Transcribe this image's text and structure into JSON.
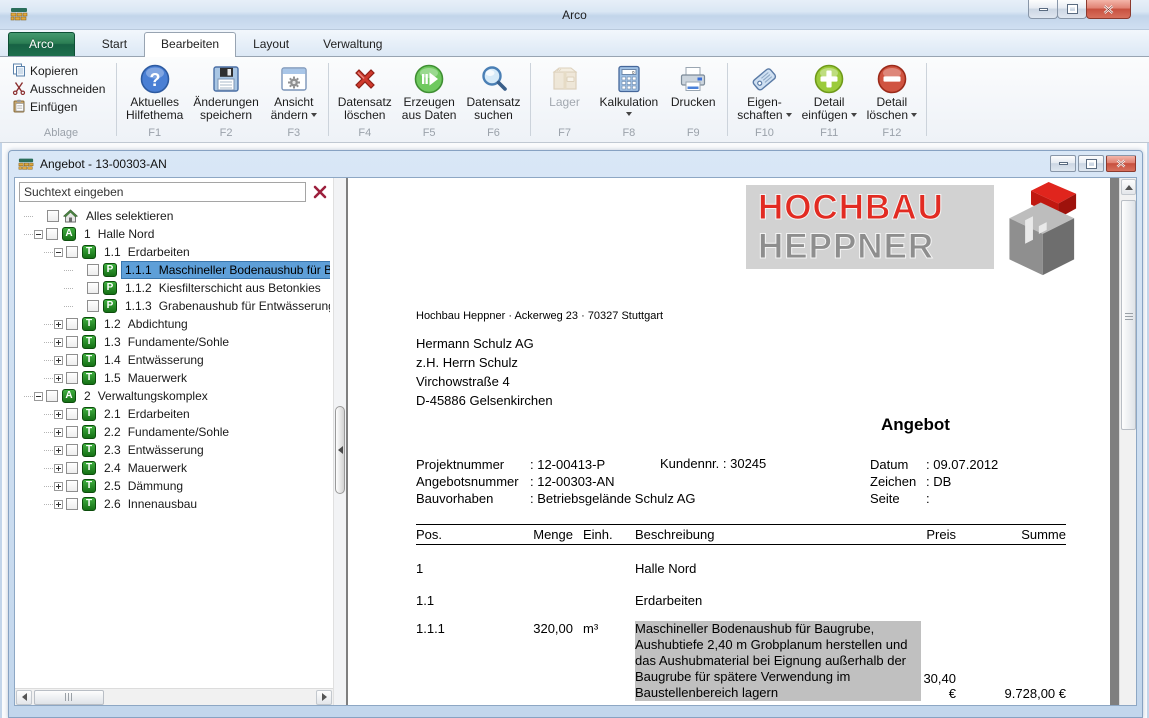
{
  "window": {
    "title": "Arco"
  },
  "tabs": {
    "app": "Arco",
    "items": [
      "Start",
      "Bearbeiten",
      "Layout",
      "Verwaltung"
    ],
    "active": "Bearbeiten"
  },
  "ribbon": {
    "small_group": {
      "label": "Ablage",
      "items": [
        {
          "label": "Kopieren",
          "icon": "copy"
        },
        {
          "label": "Ausschneiden",
          "icon": "scissors"
        },
        {
          "label": "Einfügen",
          "icon": "paste"
        }
      ]
    },
    "separators_after": [
      "F3",
      "F6",
      "F9",
      "F12"
    ],
    "buttons": [
      {
        "line1": "Aktuelles",
        "line2": "Hilfethema",
        "key": "F1",
        "icon": "help",
        "dropdown": false,
        "disabled": false
      },
      {
        "line1": "Änderungen",
        "line2": "speichern",
        "key": "F2",
        "icon": "save",
        "dropdown": false,
        "disabled": false
      },
      {
        "line1": "Ansicht",
        "line2": "ändern",
        "key": "F3",
        "icon": "view",
        "dropdown": true,
        "disabled": false
      },
      {
        "line1": "Datensatz",
        "line2": "löschen",
        "key": "F4",
        "icon": "delete-x",
        "dropdown": false,
        "disabled": false
      },
      {
        "line1": "Erzeugen",
        "line2": "aus Daten",
        "key": "F5",
        "icon": "generate",
        "dropdown": false,
        "disabled": false
      },
      {
        "line1": "Datensatz",
        "line2": "suchen",
        "key": "F6",
        "icon": "search",
        "dropdown": false,
        "disabled": false
      },
      {
        "line1": "Lager",
        "line2": "",
        "key": "F7",
        "icon": "package",
        "dropdown": false,
        "disabled": true
      },
      {
        "line1": "Kalkulation",
        "line2": "",
        "key": "F8",
        "icon": "calculator",
        "dropdown": true,
        "disabled": false
      },
      {
        "line1": "Drucken",
        "line2": "",
        "key": "F9",
        "icon": "printer",
        "dropdown": false,
        "disabled": false
      },
      {
        "line1": "Eigen-",
        "line2": "schaften",
        "key": "F10",
        "icon": "tag",
        "dropdown": true,
        "disabled": false
      },
      {
        "line1": "Detail",
        "line2": "einfügen",
        "key": "F11",
        "icon": "plus-circle",
        "dropdown": true,
        "disabled": false
      },
      {
        "line1": "Detail",
        "line2": "löschen",
        "key": "F12",
        "icon": "minus-circle",
        "dropdown": true,
        "disabled": false
      }
    ]
  },
  "child": {
    "title": "Angebot - 13-00303-AN",
    "search_value": "Suchtext eingeben",
    "tree": [
      {
        "num": "",
        "text": "Alles selektieren",
        "badge": "house",
        "level": 0,
        "expander": "none",
        "selected": false
      },
      {
        "num": "1",
        "text": "Halle Nord",
        "badge": "A",
        "level": 0,
        "expander": "minus",
        "selected": false
      },
      {
        "num": "1.1",
        "text": "Erdarbeiten",
        "badge": "T",
        "level": 1,
        "expander": "minus",
        "selected": false
      },
      {
        "num": "1.1.1",
        "text": "Maschineller Bodenaushub für Bau",
        "badge": "P",
        "level": 2,
        "expander": "none",
        "selected": true
      },
      {
        "num": "1.1.2",
        "text": "Kiesfilterschicht aus Betonkies",
        "badge": "P",
        "level": 2,
        "expander": "none",
        "selected": false
      },
      {
        "num": "1.1.3",
        "text": "Grabenaushub für Entwässerung",
        "badge": "P",
        "level": 2,
        "expander": "none",
        "selected": false
      },
      {
        "num": "1.2",
        "text": "Abdichtung",
        "badge": "T",
        "level": 1,
        "expander": "plus",
        "selected": false
      },
      {
        "num": "1.3",
        "text": "Fundamente/Sohle",
        "badge": "T",
        "level": 1,
        "expander": "plus",
        "selected": false
      },
      {
        "num": "1.4",
        "text": "Entwässerung",
        "badge": "T",
        "level": 1,
        "expander": "plus",
        "selected": false
      },
      {
        "num": "1.5",
        "text": "Mauerwerk",
        "badge": "T",
        "level": 1,
        "expander": "plus",
        "selected": false
      },
      {
        "num": "2",
        "text": "Verwaltungskomplex",
        "badge": "A",
        "level": 0,
        "expander": "minus",
        "selected": false
      },
      {
        "num": "2.1",
        "text": "Erdarbeiten",
        "badge": "T",
        "level": 1,
        "expander": "plus",
        "selected": false
      },
      {
        "num": "2.2",
        "text": "Fundamente/Sohle",
        "badge": "T",
        "level": 1,
        "expander": "plus",
        "selected": false
      },
      {
        "num": "2.3",
        "text": "Entwässerung",
        "badge": "T",
        "level": 1,
        "expander": "plus",
        "selected": false
      },
      {
        "num": "2.4",
        "text": "Mauerwerk",
        "badge": "T",
        "level": 1,
        "expander": "plus",
        "selected": false
      },
      {
        "num": "2.5",
        "text": "Dämmung",
        "badge": "T",
        "level": 1,
        "expander": "plus",
        "selected": false
      },
      {
        "num": "2.6",
        "text": "Innenausbau",
        "badge": "T",
        "level": 1,
        "expander": "plus",
        "selected": false
      }
    ]
  },
  "document": {
    "logo": {
      "line1": "HOCHBAU",
      "line2": "HEPPNER"
    },
    "sender_line": "Hochbau Heppner · Ackerweg 23 · 70327 Stuttgart",
    "recipient": [
      "Hermann Schulz AG",
      "z.H. Herrn Schulz",
      "Virchowstraße 4",
      "D-45886 Gelsenkirchen"
    ],
    "title": "Angebot",
    "info_left": [
      {
        "label": "Projektnummer",
        "value": "12-00413-P"
      },
      {
        "label": "Angebotsnummer",
        "value": "12-00303-AN"
      },
      {
        "label": "Bauvorhaben",
        "value": "Betriebsgelände Schulz AG"
      }
    ],
    "kundennr": {
      "label": "Kundennr.",
      "value": "30245"
    },
    "info_right": [
      {
        "label": "Datum",
        "value": "09.07.2012"
      },
      {
        "label": "Zeichen",
        "value": "DB"
      },
      {
        "label": "Seite",
        "value": ""
      }
    ],
    "table": {
      "headers": {
        "pos": "Pos.",
        "menge": "Menge",
        "einh": "Einh.",
        "beschreibung": "Beschreibung",
        "preis": "Preis",
        "summe": "Summe"
      },
      "rows": [
        {
          "pos": "1",
          "menge": "",
          "einh": "",
          "desc": "Halle Nord",
          "preis": "",
          "summe": "",
          "highlight": false
        },
        {
          "pos": "1.1",
          "menge": "",
          "einh": "",
          "desc": "Erdarbeiten",
          "preis": "",
          "summe": "",
          "highlight": false
        },
        {
          "pos": "1.1.1",
          "menge": "320,00",
          "einh": "m³",
          "desc": "Maschineller Bodenaushub für Baugrube, Aushubtiefe 2,40 m Grobplanum herstellen und das Aushubmaterial bei Eignung außerhalb der Baugrube für spätere Verwendung im Baustellenbereich lagern",
          "preis": "30,40 €",
          "summe": "9.728,00 €",
          "highlight": true
        }
      ]
    }
  },
  "colors": {
    "accent_green": "#1d6f4d",
    "selection_blue": "#5e9fd8",
    "logo_red": "#e22b22",
    "logo_gray": "#8e8e8e",
    "badge_green": "#157015",
    "highlight_gray": "#c0c0c0"
  }
}
